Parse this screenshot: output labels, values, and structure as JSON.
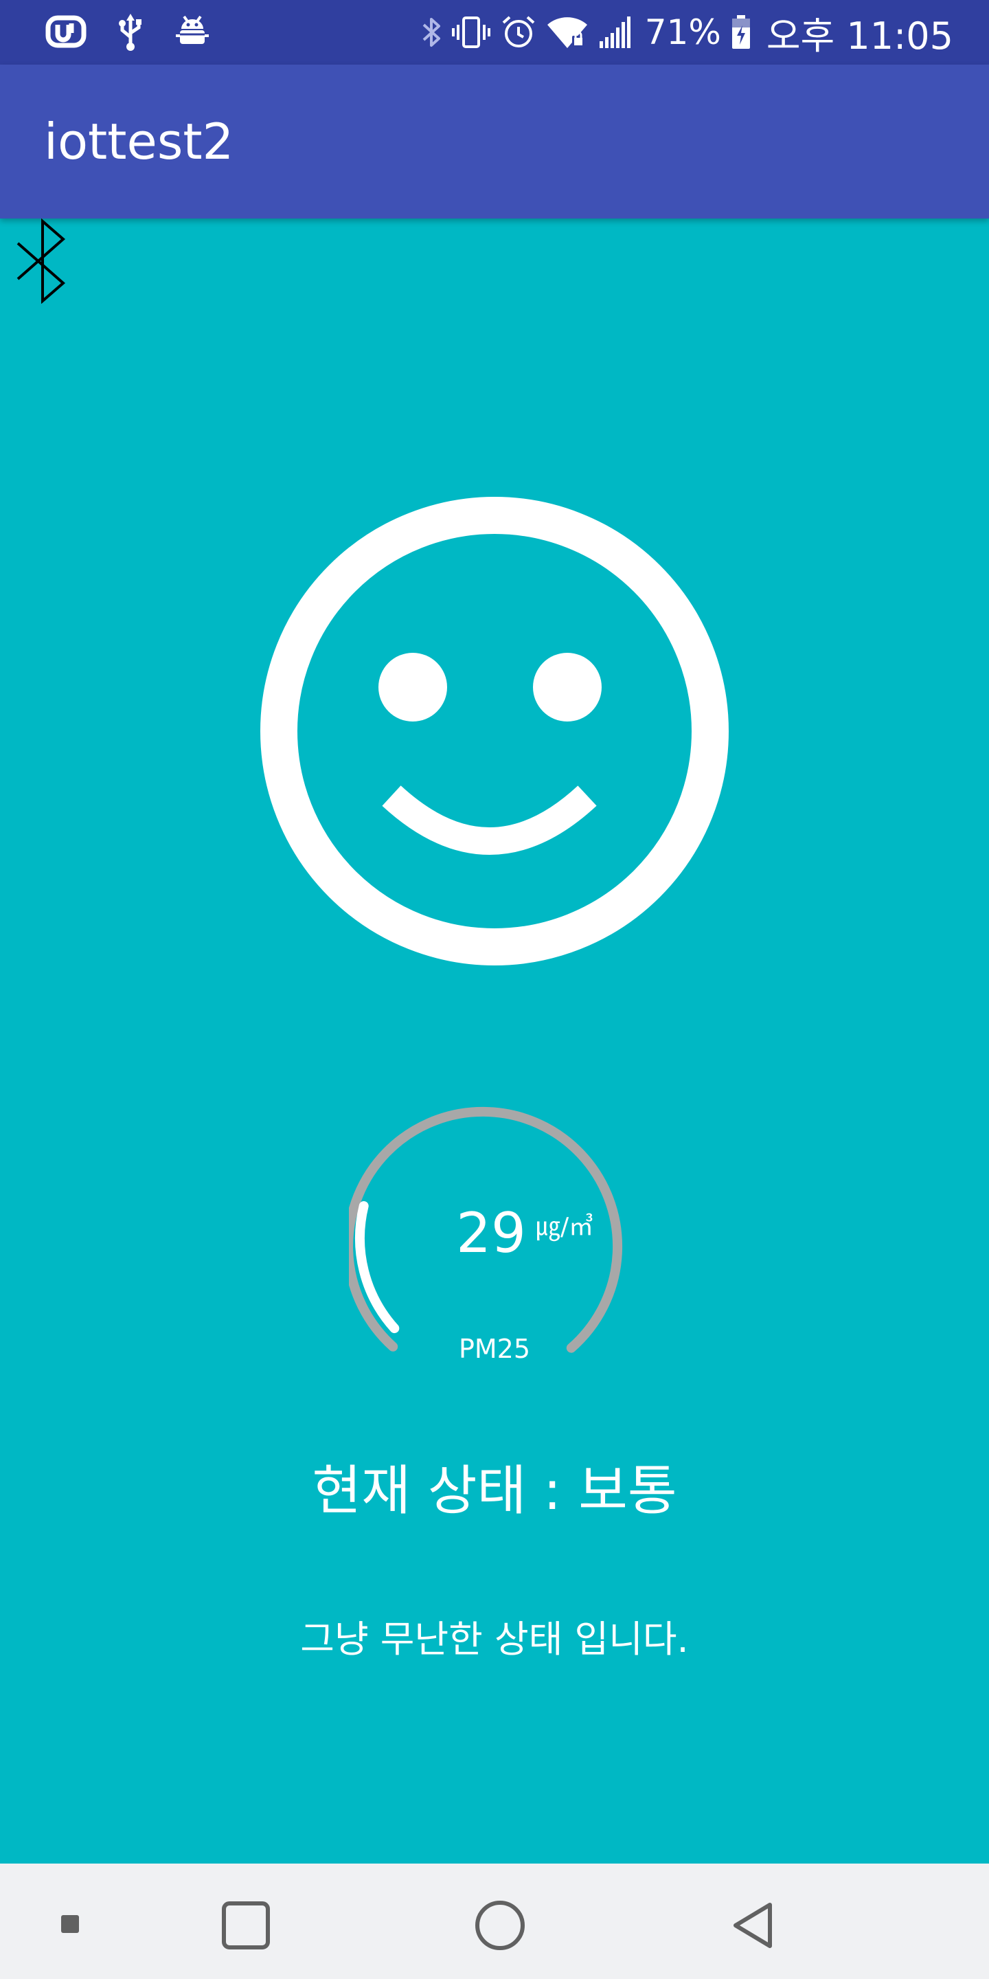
{
  "status_bar": {
    "icons_left": [
      "u-plus-icon",
      "usb-icon",
      "android-debug-icon"
    ],
    "icons_right": [
      "bluetooth-icon",
      "vibrate-icon",
      "alarm-icon",
      "wifi-icon",
      "signal-icon"
    ],
    "battery_percent": "71%",
    "battery_icon": "battery-charging-icon",
    "time": "오후 11:05",
    "background": "#303F9F"
  },
  "app_bar": {
    "title": "iottest2",
    "background": "#3F51B5"
  },
  "bluetooth_button": {
    "icon": "bluetooth-icon"
  },
  "status_face": {
    "icon": "smiley-face-icon",
    "color": "#FFFFFF"
  },
  "gauge": {
    "value": "29",
    "unit": "㎍/㎥",
    "label": "PM25",
    "fill_fraction": 0.21,
    "track_color": "#A8A8A8",
    "fill_color": "#FFFFFF"
  },
  "status": {
    "title": "현재 상태 : 보통",
    "description": "그냥 무난한 상태 입니다."
  },
  "nav_bar": {
    "items": [
      "menu-dot-icon",
      "recents-icon",
      "home-icon",
      "back-icon"
    ],
    "background": "#F0F1F3"
  },
  "theme": {
    "background": "#00B8C4"
  }
}
